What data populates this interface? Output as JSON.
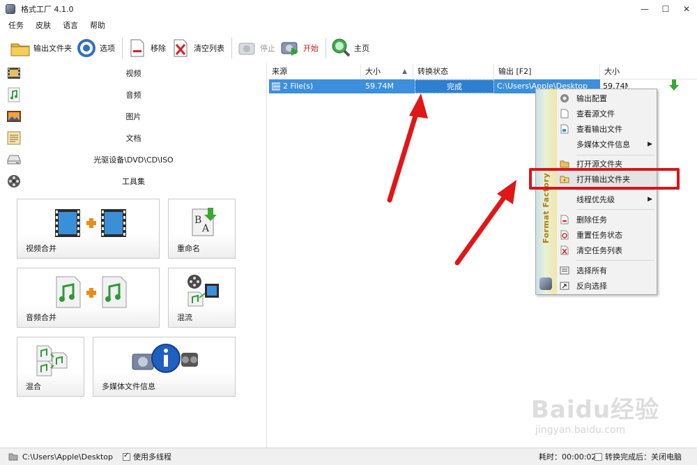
{
  "window": {
    "title": "格式工厂 4.1.0",
    "controls": [
      "—",
      "☐",
      "✕"
    ]
  },
  "menu": [
    "任务",
    "皮肤",
    "语言",
    "帮助"
  ],
  "toolbar": {
    "output_folder": "输出文件夹",
    "options": "选项",
    "remove": "移除",
    "clear_list": "清空列表",
    "stop": "停止",
    "start": "开始",
    "home": "主页"
  },
  "categories": [
    {
      "label": "视频",
      "icon": "film-icon"
    },
    {
      "label": "音频",
      "icon": "music-note-icon"
    },
    {
      "label": "图片",
      "icon": "picture-icon"
    },
    {
      "label": "文档",
      "icon": "document-icon"
    },
    {
      "label": "光驱设备\\DVD\\CD\\ISO",
      "icon": "disc-drive-icon"
    },
    {
      "label": "工具集",
      "icon": "film-reel-icon"
    }
  ],
  "tools": [
    {
      "label": "视频合并"
    },
    {
      "label": "重命名"
    },
    {
      "label": "音频合并"
    },
    {
      "label": "混流"
    },
    {
      "label": "混合"
    },
    {
      "label": "多媒体文件信息"
    }
  ],
  "list": {
    "columns": [
      "来源",
      "大小",
      "转换状态",
      "输出 [F2]",
      "大小"
    ],
    "rows": [
      {
        "source": "2 File(s)",
        "size": "59.74M",
        "status": "完成",
        "output": "C:\\Users\\Apple\\Desktop",
        "out_size": "59.74M"
      }
    ]
  },
  "context_menu": {
    "brand": "Format Factory",
    "items": [
      {
        "label": "输出配置",
        "icon": "gear-icon"
      },
      {
        "label": "查看源文件",
        "icon": "file-icon"
      },
      {
        "label": "查看输出文件",
        "icon": "file-output-icon"
      },
      {
        "label": "多媒体文件信息",
        "icon": "",
        "submenu": true
      },
      {
        "label": "打开源文件夹",
        "icon": "folder-icon"
      },
      {
        "label": "打开输出文件夹",
        "icon": "folder-open-icon",
        "highlighted": true
      },
      {
        "label": "线程优先级",
        "icon": "",
        "submenu": true
      },
      {
        "label": "删除任务",
        "icon": "delete-file-icon"
      },
      {
        "label": "重置任务状态",
        "icon": "reset-icon"
      },
      {
        "label": "清空任务列表",
        "icon": "clear-list-icon"
      },
      {
        "label": "选择所有",
        "icon": "select-all-icon"
      },
      {
        "label": "反向选择",
        "icon": "invert-selection-icon"
      }
    ]
  },
  "status": {
    "path": "C:\\Users\\Apple\\Desktop",
    "multithread_label": "使用多线程",
    "multithread_checked": true,
    "elapsed": "耗时：00:00:02",
    "after_done_label": "转换完成后：关闭电脑",
    "after_done_checked": false
  },
  "watermark": {
    "text": "Baidu经验",
    "url": "jingyan.baidu.com"
  },
  "colors": {
    "selection": "#3c8fdc",
    "highlight_box": "#d9141a",
    "arrow": "#e01717",
    "download_arrow": "#3aa832"
  }
}
